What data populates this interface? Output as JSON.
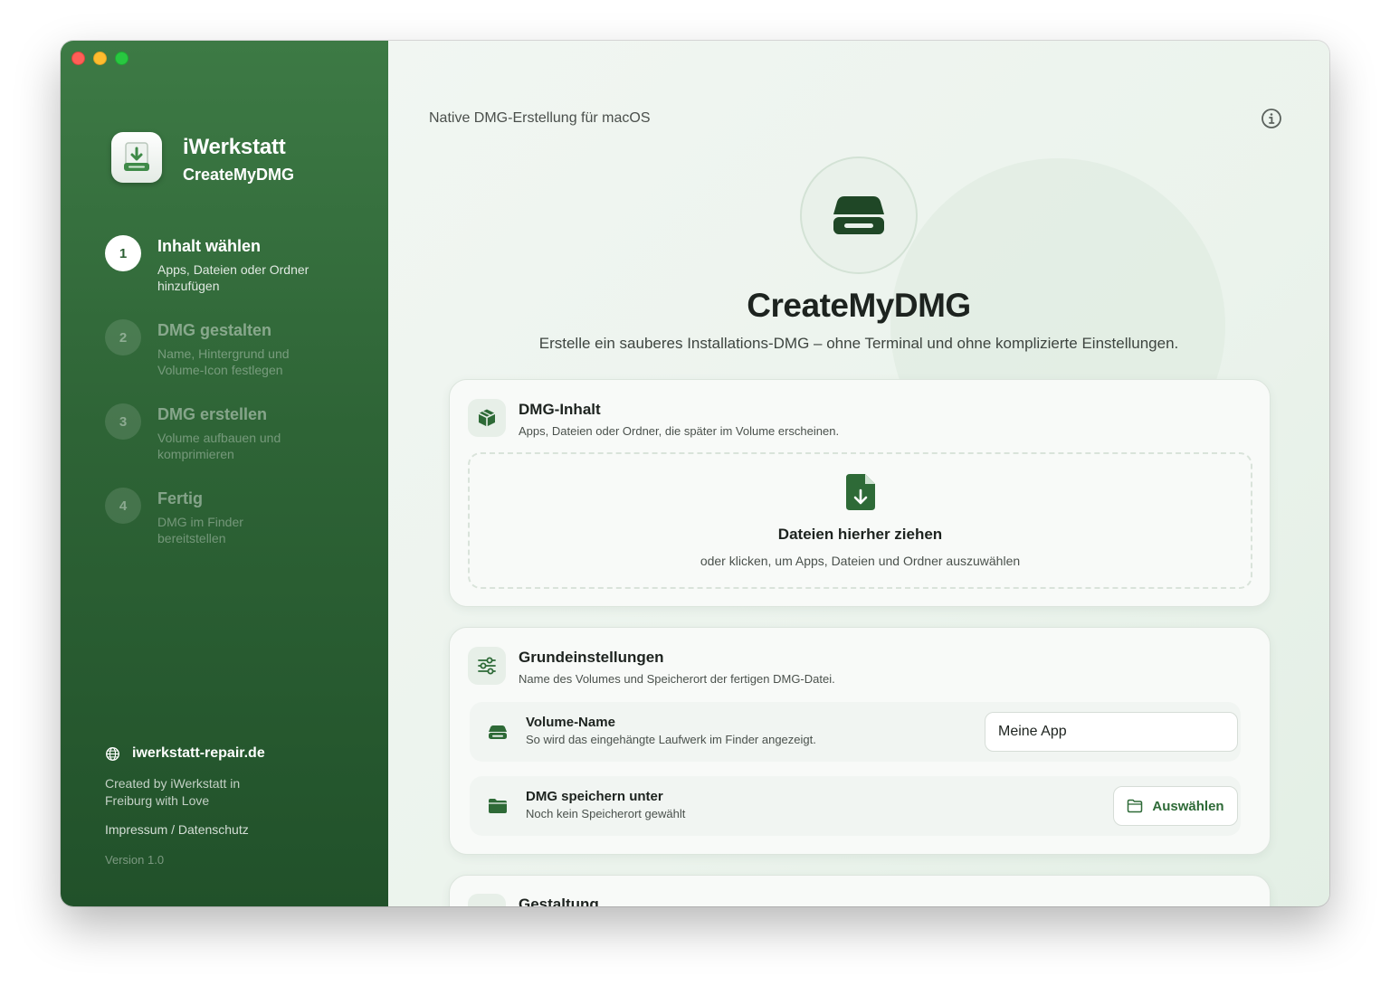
{
  "window_controls": {
    "close": "close",
    "minimize": "minimize",
    "maximize": "maximize"
  },
  "sidebar": {
    "brand_name": "iWerkstatt",
    "app_name": "CreateMyDMG",
    "steps": [
      {
        "number": "1",
        "title": "Inhalt wählen",
        "description": "Apps, Dateien oder Ordner hinzufügen",
        "active": true
      },
      {
        "number": "2",
        "title": "DMG gestalten",
        "description": "Name, Hintergrund und Volume-Icon festlegen",
        "active": false
      },
      {
        "number": "3",
        "title": "DMG erstellen",
        "description": "Volume aufbauen und komprimieren",
        "active": false
      },
      {
        "number": "4",
        "title": "Fertig",
        "description": "DMG im Finder bereitstellen",
        "active": false
      }
    ],
    "footer": {
      "website": "iwerkstatt-repair.de",
      "credit": "Created by iWerkstatt in Freiburg with Love",
      "legal": "Impressum / Datenschutz",
      "version": "Version 1.0"
    }
  },
  "main": {
    "top_label": "Native DMG-Erstellung für macOS",
    "hero": {
      "title": "CreateMyDMG",
      "subtitle": "Erstelle ein sauberes Installations-DMG – ohne Terminal und ohne komplizierte Einstellungen."
    },
    "content_card": {
      "title": "DMG-Inhalt",
      "description": "Apps, Dateien oder Ordner, die später im Volume erscheinen.",
      "dropzone_title": "Dateien hierher ziehen",
      "dropzone_subtitle": "oder klicken, um Apps, Dateien und Ordner auszuwählen"
    },
    "settings_card": {
      "title": "Grundeinstellungen",
      "description": "Name des Volumes und Speicherort der fertigen DMG-Datei.",
      "volume_name": {
        "title": "Volume-Name",
        "description": "So wird das eingehängte Laufwerk im Finder angezeigt.",
        "value": "Meine App"
      },
      "save_location": {
        "title": "DMG speichern unter",
        "description": "Noch kein Speicherort gewählt",
        "button_label": "Auswählen"
      }
    },
    "design_card": {
      "title": "Gestaltung"
    }
  },
  "colors": {
    "accent": "#2e6a37",
    "sidebar_top": "#3d7a45",
    "sidebar_bottom": "#21512a",
    "background": "#eef4ef"
  }
}
